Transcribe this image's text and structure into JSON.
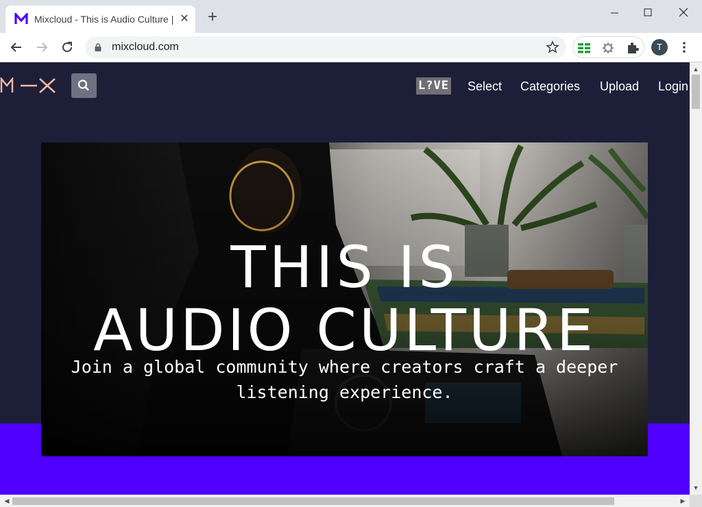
{
  "browser": {
    "tab_title": "Mixcloud - This is Audio Culture | Mixcloud",
    "tab_close": "✕",
    "new_tab": "+",
    "url": "mixcloud.com",
    "profile_initial": "T"
  },
  "site": {
    "nav": {
      "live_label": "L?VE",
      "select_label": "Select",
      "categories_label": "Categories",
      "upload_label": "Upload",
      "login_label": "Login"
    },
    "hero": {
      "title_line1": "THIS IS",
      "title_line2": "AUDIO CULTURE",
      "subtitle_line1": "Join a global community where creators craft a deeper",
      "subtitle_line2": "listening experience."
    }
  },
  "colors": {
    "page_bg": "#1d1f39",
    "brand_purple": "#5000ff",
    "logo_color": "#f5b9a4"
  }
}
